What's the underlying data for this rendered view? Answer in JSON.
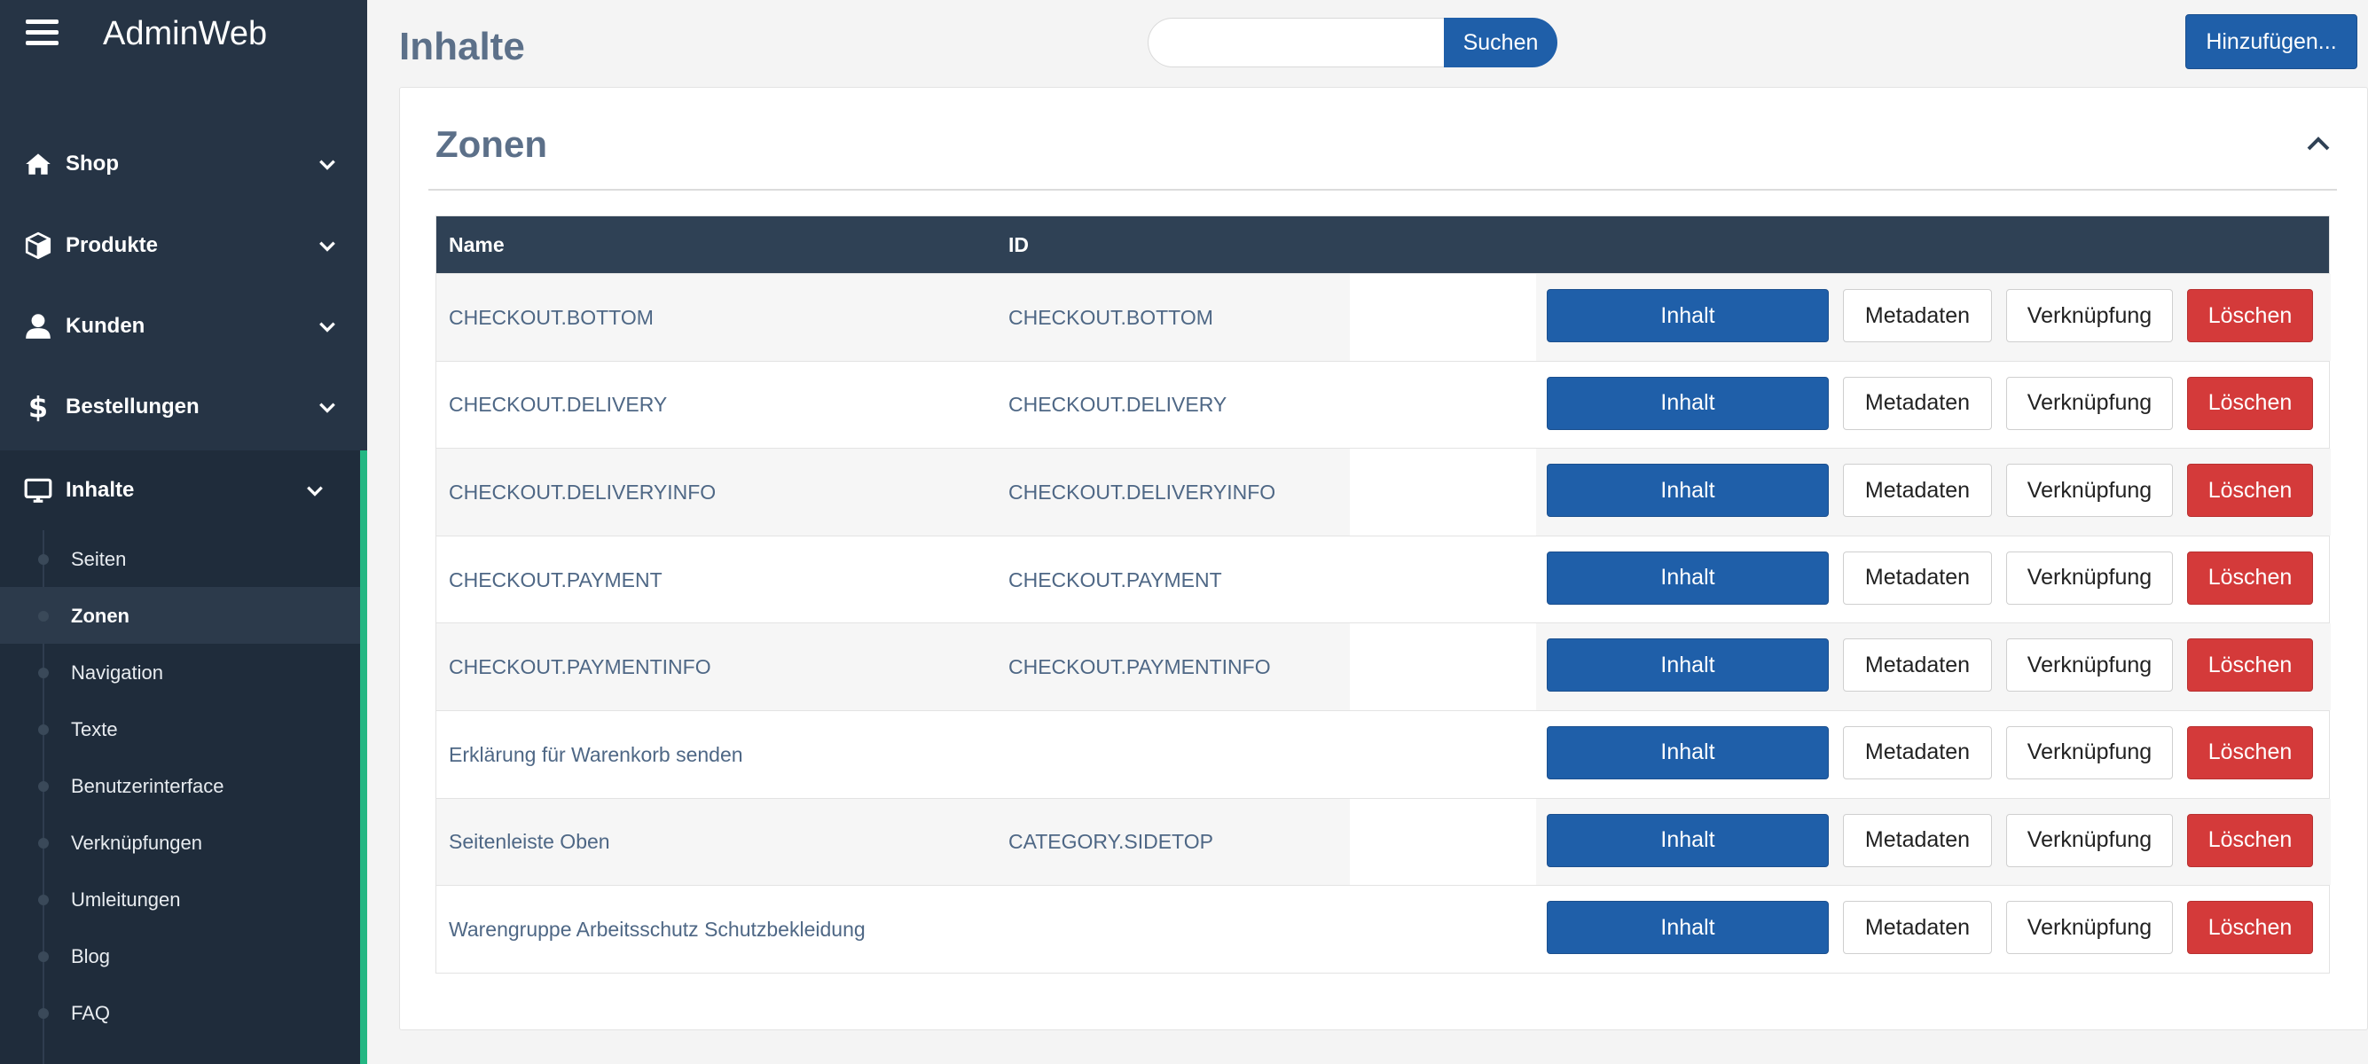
{
  "app": {
    "brand": "AdminWeb"
  },
  "sidebar": {
    "items": [
      {
        "label": "Shop",
        "icon": "home-icon"
      },
      {
        "label": "Produkte",
        "icon": "box-icon"
      },
      {
        "label": "Kunden",
        "icon": "user-icon"
      },
      {
        "label": "Bestellungen",
        "icon": "dollar-icon"
      },
      {
        "label": "Inhalte",
        "icon": "monitor-icon",
        "active": true
      }
    ],
    "sub_items": [
      {
        "label": "Seiten"
      },
      {
        "label": "Zonen",
        "active": true
      },
      {
        "label": "Navigation"
      },
      {
        "label": "Texte"
      },
      {
        "label": "Benutzerinterface"
      },
      {
        "label": "Verknüpfungen"
      },
      {
        "label": "Umleitungen"
      },
      {
        "label": "Blog"
      },
      {
        "label": "FAQ"
      }
    ]
  },
  "header": {
    "title": "Inhalte",
    "search_placeholder": "",
    "search_button": "Suchen",
    "add_button": "Hinzufügen..."
  },
  "card": {
    "title": "Zonen",
    "columns": {
      "name": "Name",
      "id": "ID"
    },
    "actions": {
      "content": "Inhalt",
      "metadata": "Metadaten",
      "link": "Verknüpfung",
      "delete": "Löschen"
    },
    "rows": [
      {
        "name": "CHECKOUT.BOTTOM",
        "id": "CHECKOUT.BOTTOM"
      },
      {
        "name": "CHECKOUT.DELIVERY",
        "id": "CHECKOUT.DELIVERY"
      },
      {
        "name": "CHECKOUT.DELIVERYINFO",
        "id": "CHECKOUT.DELIVERYINFO"
      },
      {
        "name": "CHECKOUT.PAYMENT",
        "id": "CHECKOUT.PAYMENT"
      },
      {
        "name": "CHECKOUT.PAYMENTINFO",
        "id": "CHECKOUT.PAYMENTINFO"
      },
      {
        "name": "Erklärung für Warenkorb senden",
        "id": ""
      },
      {
        "name": "Seitenleiste Oben",
        "id": "CATEGORY.SIDETOP"
      },
      {
        "name": "Warengruppe Arbeitsschutz Schutzbekleidung",
        "id": ""
      }
    ]
  },
  "colors": {
    "sidebar_bg": "#263445",
    "accent_green": "#24b783",
    "primary_blue": "#1f5fa9",
    "danger_red": "#d43a3a",
    "table_header": "#2f4155"
  }
}
